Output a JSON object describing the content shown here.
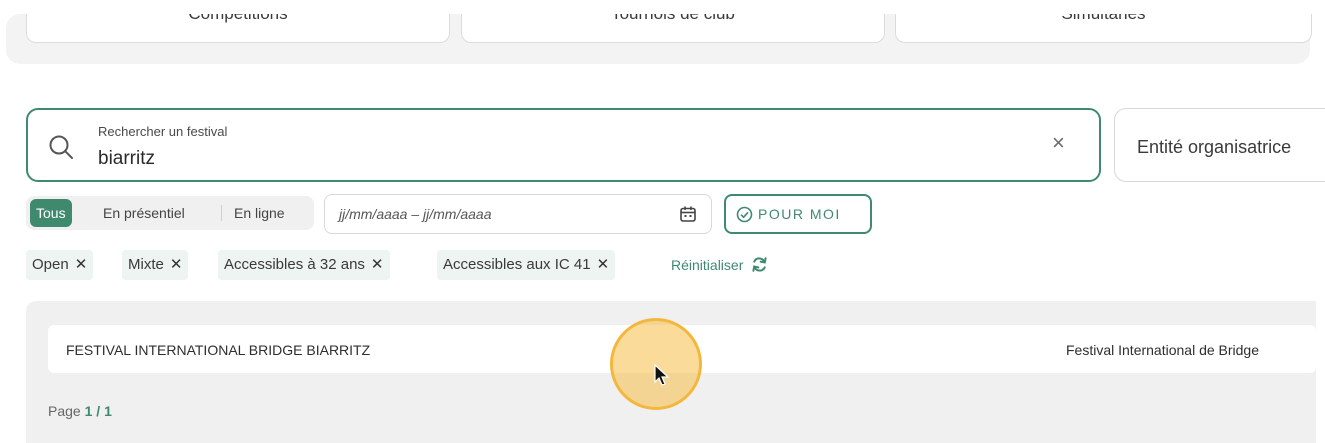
{
  "top_tabs": [
    {
      "label": "Compétitions"
    },
    {
      "label": "Tournois de club"
    },
    {
      "label": "Simultanés"
    }
  ],
  "search": {
    "label": "Rechercher un festival",
    "value": "biarritz",
    "clear": "×"
  },
  "entity_filter": {
    "label": "Entité organisatrice"
  },
  "mode": {
    "items": [
      {
        "label": "Tous",
        "active": true
      },
      {
        "label": "En présentiel",
        "active": false
      },
      {
        "label": "En ligne",
        "active": false
      }
    ]
  },
  "date_range": {
    "placeholder": "jj/mm/aaaa – jj/mm/aaaa"
  },
  "pour_moi": {
    "label": "POUR MOI"
  },
  "chips": [
    {
      "label": "Open"
    },
    {
      "label": "Mixte"
    },
    {
      "label": "Accessibles à 32 ans"
    },
    {
      "label": "Accessibles aux IC 41"
    }
  ],
  "chip_remove": "✕",
  "reset": {
    "label": "Réinitialiser"
  },
  "results": [
    {
      "name": "FESTIVAL INTERNATIONAL BRIDGE BIARRITZ",
      "organizer": "Festival International de Bridge"
    }
  ],
  "pagination": {
    "prefix": "Page",
    "current": "1",
    "separator": "/",
    "total": "1"
  },
  "colors": {
    "accent": "#3f8a6f",
    "chip_bg": "#eef4f1",
    "cursor_highlight": "#f3b73d"
  }
}
